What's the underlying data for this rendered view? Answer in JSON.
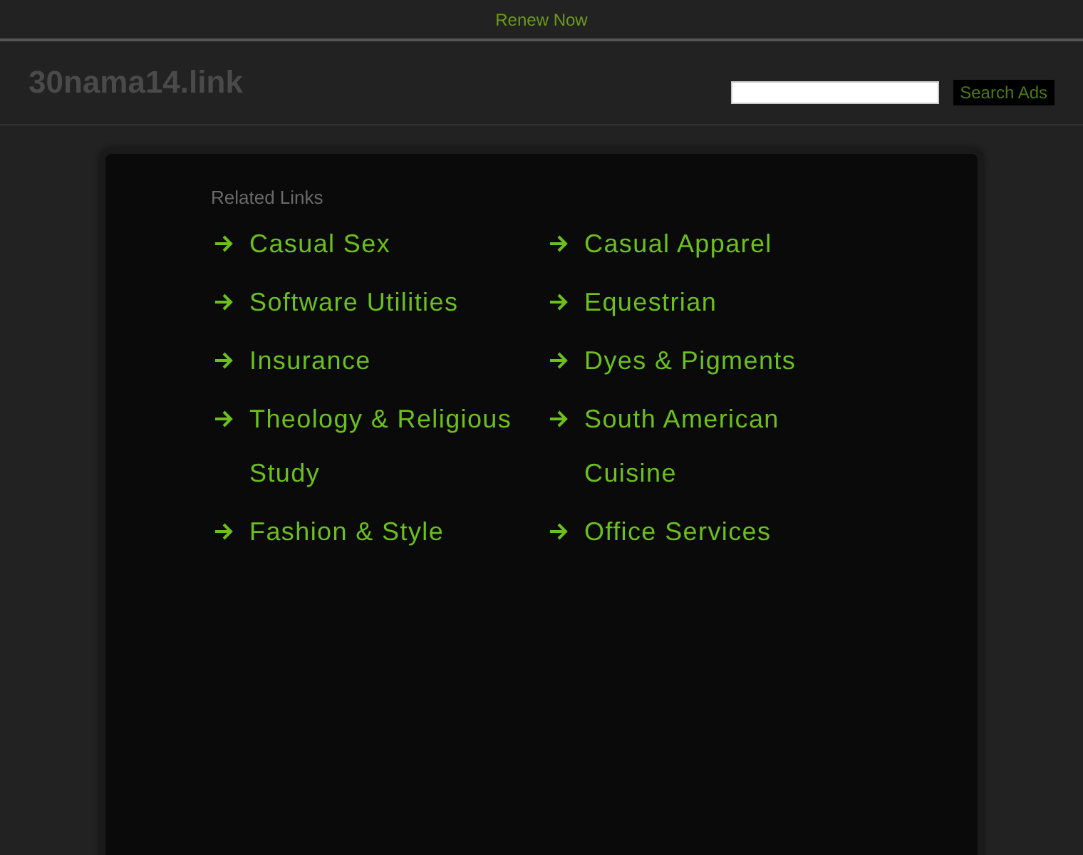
{
  "top_bar": {
    "link": "Renew Now"
  },
  "header": {
    "domain": "30nama14.link",
    "search": {
      "button": "Search Ads"
    }
  },
  "related": {
    "title": "Related Links",
    "columns": [
      [
        "Casual Sex",
        "Software Utilities",
        "Insurance",
        "Theology & Religious Study",
        "Fashion & Style"
      ],
      [
        "Casual Apparel",
        "Equestrian",
        "Dyes & Pigments",
        "South American Cuisine",
        "Office Services"
      ]
    ]
  }
}
